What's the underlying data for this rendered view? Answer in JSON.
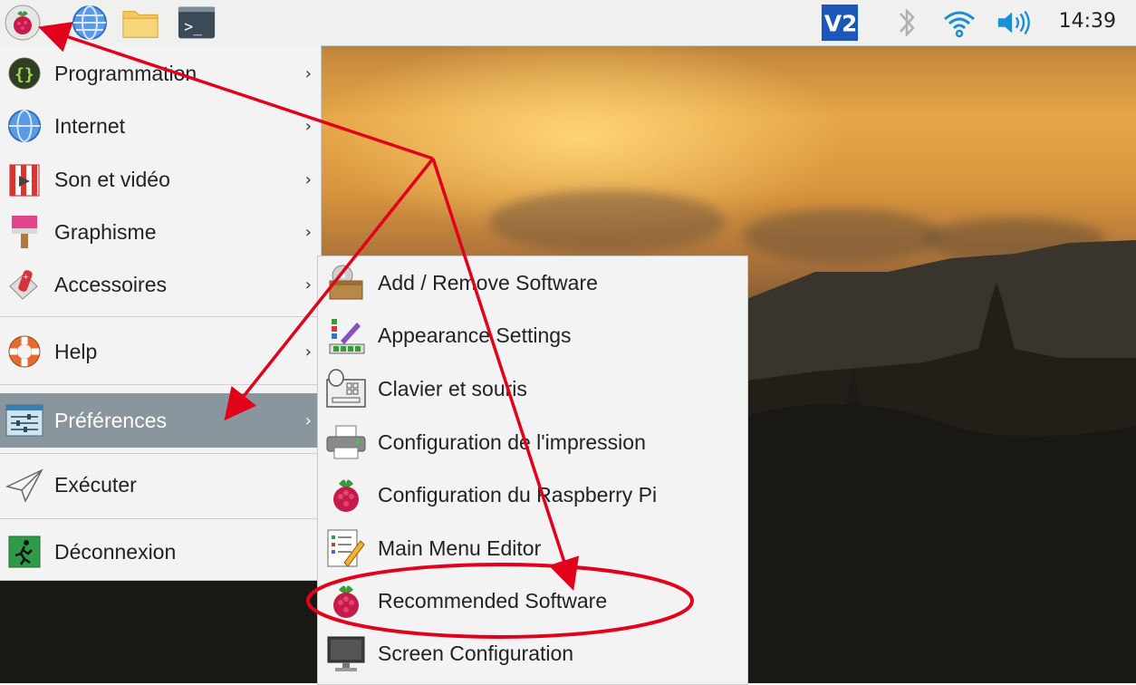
{
  "taskbar": {
    "clock": "14:39",
    "icons": [
      "raspberry-menu-icon",
      "globe-icon",
      "folder-icon",
      "terminal-icon",
      "vnc-icon",
      "bluetooth-icon",
      "wifi-icon",
      "volume-icon"
    ],
    "terminal_prompt": ">_",
    "vnc_text": "V2"
  },
  "main_menu": {
    "items": [
      {
        "label": "Programmation",
        "icon": "programming-icon"
      },
      {
        "label": "Internet",
        "icon": "globe-icon"
      },
      {
        "label": "Son et vidéo",
        "icon": "media-icon"
      },
      {
        "label": "Graphisme",
        "icon": "paintbrush-icon"
      },
      {
        "label": "Accessoires",
        "icon": "accessories-icon"
      },
      {
        "label": "Help",
        "icon": "lifebuoy-icon"
      },
      {
        "label": "Préférences",
        "icon": "preferences-icon",
        "active": true
      },
      {
        "label": "Exécuter",
        "icon": "paper-plane-icon"
      },
      {
        "label": "Déconnexion",
        "icon": "exit-icon"
      }
    ],
    "arrow": "›"
  },
  "sub_menu": {
    "items": [
      {
        "label": "Add / Remove Software",
        "icon": "package-icon"
      },
      {
        "label": "Appearance Settings",
        "icon": "appearance-icon"
      },
      {
        "label": "Clavier et souris",
        "icon": "keyboard-mouse-icon"
      },
      {
        "label": "Configuration de l'impression",
        "icon": "printer-icon"
      },
      {
        "label": "Configuration du Raspberry Pi",
        "icon": "raspberry-icon"
      },
      {
        "label": "Main Menu Editor",
        "icon": "menu-editor-icon"
      },
      {
        "label": "Recommended Software",
        "icon": "raspberry-icon",
        "highlighted": true
      },
      {
        "label": "Screen Configuration",
        "icon": "monitor-icon"
      }
    ]
  },
  "colors": {
    "annotation": "#e3001b",
    "active_item": "#8a969e"
  }
}
